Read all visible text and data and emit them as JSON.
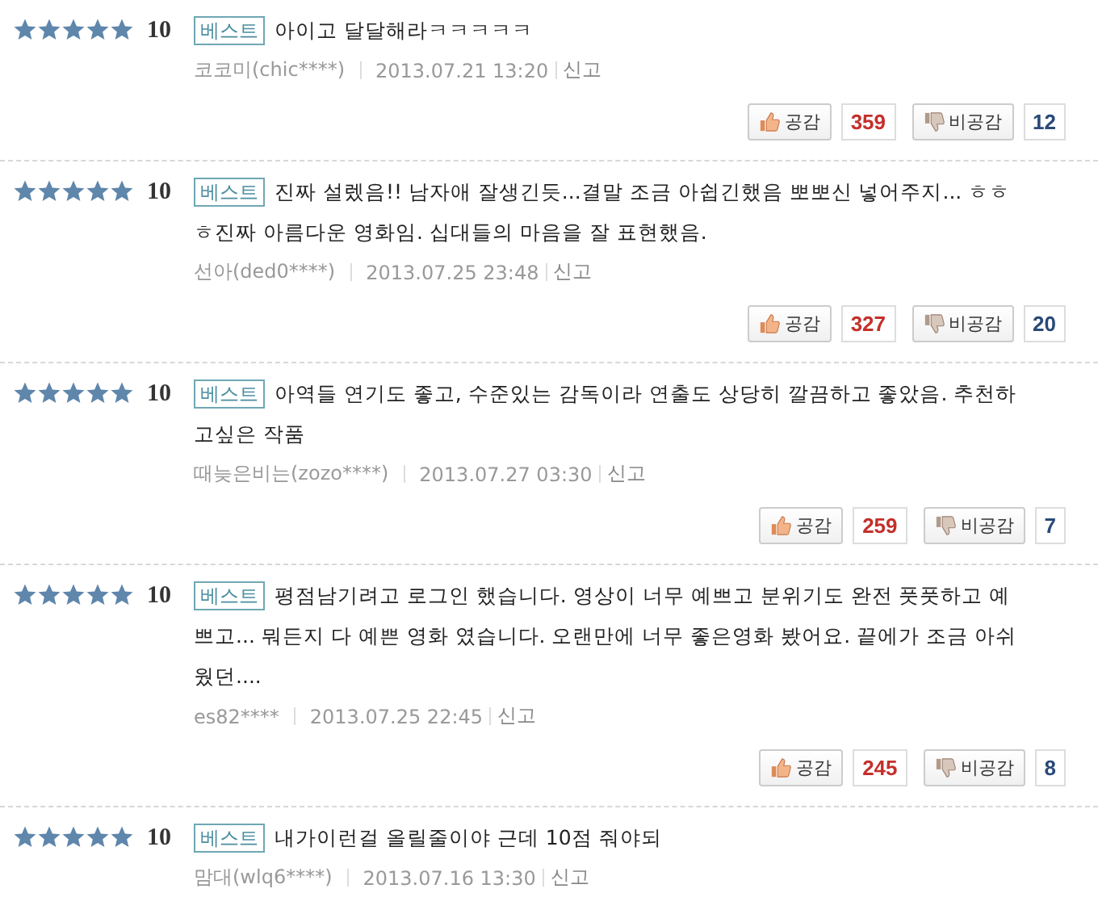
{
  "reviews": [
    {
      "stars": 5,
      "score": "10",
      "badge": "베스트",
      "text": "아이고 달달해라ㅋㅋㅋㅋㅋ",
      "author": "코코미(chic****)",
      "date": "2013.07.21 13:20",
      "report": "신고",
      "like_label": "공감",
      "likes": "359",
      "dislike_label": "비공감",
      "dislikes": "12"
    },
    {
      "stars": 5,
      "score": "10",
      "badge": "베스트",
      "text": "진짜 설렜음!! 남자애 잘생긴듯...결말 조금 아쉽긴했음 뽀뽀신 넣어주지... ㅎㅎㅎ진짜 아름다운 영화임. 십대들의 마음을 잘 표현했음.",
      "author": "선아(ded0****)",
      "date": "2013.07.25 23:48",
      "report": "신고",
      "like_label": "공감",
      "likes": "327",
      "dislike_label": "비공감",
      "dislikes": "20"
    },
    {
      "stars": 5,
      "score": "10",
      "badge": "베스트",
      "text": "아역들 연기도 좋고, 수준있는 감독이라 연출도 상당히 깔끔하고 좋았음. 추천하고싶은 작품",
      "author": "때늦은비는(zozo****)",
      "date": "2013.07.27 03:30",
      "report": "신고",
      "like_label": "공감",
      "likes": "259",
      "dislike_label": "비공감",
      "dislikes": "7"
    },
    {
      "stars": 5,
      "score": "10",
      "badge": "베스트",
      "text": "평점남기려고 로그인 했습니다. 영상이 너무 예쁘고 분위기도 완전 풋풋하고 예쁘고... 뭐든지 다 예쁜 영화 였습니다. 오랜만에 너무 좋은영화 봤어요. 끝에가 조금 아쉬웠던....",
      "author": "es82****",
      "date": "2013.07.25 22:45",
      "report": "신고",
      "like_label": "공감",
      "likes": "245",
      "dislike_label": "비공감",
      "dislikes": "8"
    },
    {
      "stars": 5,
      "score": "10",
      "badge": "베스트",
      "text": "내가이런걸 올릴줄이야 근데 10점 줘야되",
      "author": "맘대(wlq6****)",
      "date": "2013.07.16 13:30",
      "report": "신고"
    }
  ]
}
